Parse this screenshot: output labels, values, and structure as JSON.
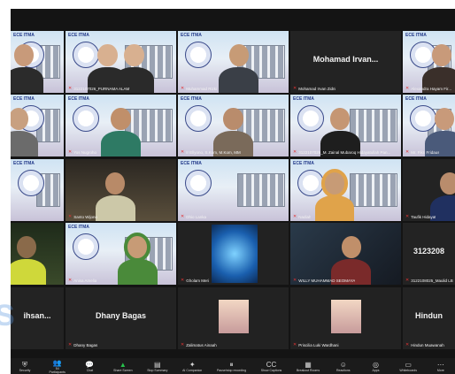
{
  "participants": [
    {
      "label": ""
    },
    {
      "label": "3122107026_PURNAMA ALAM"
    },
    {
      "label": "Muhammad Rizki"
    },
    {
      "label": "Mohamad Irvan Zidni",
      "display_name": "Mohamad Irvan..."
    },
    {
      "label": "Alexandra Hayam Fir..."
    },
    {
      "label": ""
    },
    {
      "label": "Yos Nugroho"
    },
    {
      "label": "Ir Ellyono, S.Kom, M.Kom, MM"
    },
    {
      "label": "3122107026_M. Zainal Mubaroq Hidayatullah Pan..."
    },
    {
      "label": "Mr. Fikri Fridaus"
    },
    {
      "label": ""
    },
    {
      "label": "Santo Wijono"
    },
    {
      "label": "Dhio Lanka"
    },
    {
      "label": "Nadiah"
    },
    {
      "label": "Taufik Hidayat"
    },
    {
      "label": ""
    },
    {
      "label": "Anisa Amelia"
    },
    {
      "label": "Gholam Meri"
    },
    {
      "label": "WILLY MUHAMMAD SEOMAYA"
    },
    {
      "label": "3122108025_Maulid LB",
      "display_name": "3123208"
    },
    {
      "label": "",
      "display_name": "ihsan..."
    },
    {
      "label": "Dhany Bagas",
      "display_name": "Dhany Bagas"
    },
    {
      "label": "Zalimatus Ainaah"
    },
    {
      "label": "Priscilia Luki Wardhani"
    },
    {
      "label": "Hindun Muawanah",
      "display_name": "Hindun"
    }
  ],
  "tile_brand": "ECE ITMA",
  "toolbar": [
    {
      "icon": "shield-icon",
      "label": "Security",
      "glyph": "⛨"
    },
    {
      "icon": "participants-icon",
      "label": "Participants",
      "glyph": "👥",
      "count": "54"
    },
    {
      "icon": "chat-icon",
      "label": "Chat",
      "glyph": "💬"
    },
    {
      "icon": "share-screen-icon",
      "label": "Share Screen",
      "glyph": "▲"
    },
    {
      "icon": "summary-icon",
      "label": "Stop Summary",
      "glyph": "▤"
    },
    {
      "icon": "ai-companion-icon",
      "label": "AI Companion",
      "glyph": "✦"
    },
    {
      "icon": "record-icon",
      "label": "Pause/stop recording",
      "glyph": "⏸"
    },
    {
      "icon": "captions-icon",
      "label": "Show Captions",
      "glyph": "CC"
    },
    {
      "icon": "breakout-icon",
      "label": "Breakout Rooms",
      "glyph": "▦"
    },
    {
      "icon": "reactions-icon",
      "label": "Reactions",
      "glyph": "☺"
    },
    {
      "icon": "apps-icon",
      "label": "Apps",
      "glyph": "◎"
    },
    {
      "icon": "whiteboards-icon",
      "label": "Whiteboards",
      "glyph": "▭"
    },
    {
      "icon": "more-icon",
      "label": "More",
      "glyph": "⋯"
    }
  ],
  "watermark_text": "S"
}
